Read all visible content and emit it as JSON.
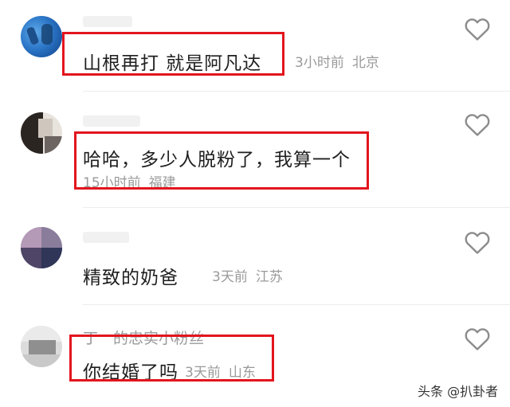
{
  "colors": {
    "highlight_box": "#e3151d",
    "secondary_text": "#9a9a9a",
    "primary_text": "#1f1f1f",
    "divider": "#ececec"
  },
  "comments": [
    {
      "text": "山根再打 就是阿凡达",
      "time": "3小时前",
      "location": "北京",
      "like_icon": "heart-outline-icon"
    },
    {
      "text": "哈哈，多少人脱粉了，我算一个",
      "time": "15小时前",
      "location": "福建",
      "like_icon": "heart-outline-icon"
    },
    {
      "text": "精致的奶爸",
      "time": "3天前",
      "location": "江苏",
      "like_icon": "heart-outline-icon"
    },
    {
      "nickname": "丁　的忠实小粉丝",
      "text": "你结婚了吗",
      "time": "3天前",
      "location": "山东",
      "like_icon": "heart-outline-icon"
    }
  ],
  "watermark": "头条 @扒卦者"
}
